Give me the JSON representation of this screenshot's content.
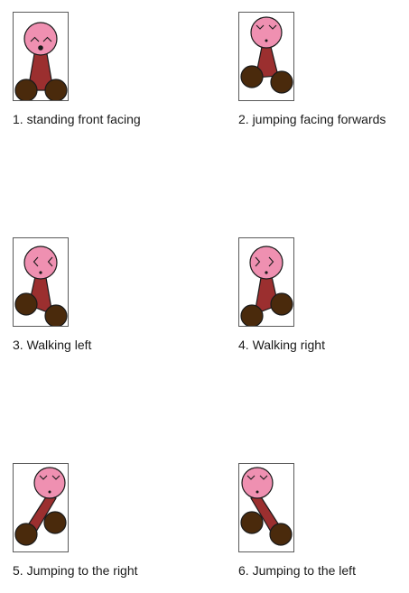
{
  "colors": {
    "head": "#ef90b1",
    "body": "#9b2f2f",
    "wheel": "#4a2a0c",
    "outline": "#1a1a1a",
    "frame": "#5a5a5a"
  },
  "sprites": [
    {
      "caption": "1. standing front facing",
      "eyes": "arched",
      "mouth": "open-o",
      "pose": "standing"
    },
    {
      "caption": "2. jumping facing forwards",
      "eyes": "v-shaped",
      "mouth": "dot",
      "pose": "jumping-forwards"
    },
    {
      "caption": "3. Walking left",
      "eyes": "pointing-left",
      "mouth": "dot",
      "pose": "walking-left"
    },
    {
      "caption": "4. Walking right",
      "eyes": "pointing-right",
      "mouth": "dot",
      "pose": "walking-right"
    },
    {
      "caption": "5. Jumping to the right",
      "eyes": "v-shaped",
      "mouth": "dot",
      "pose": "jumping-right"
    },
    {
      "caption": "6. Jumping to the left",
      "eyes": "v-shaped",
      "mouth": "dot",
      "pose": "jumping-left"
    }
  ]
}
